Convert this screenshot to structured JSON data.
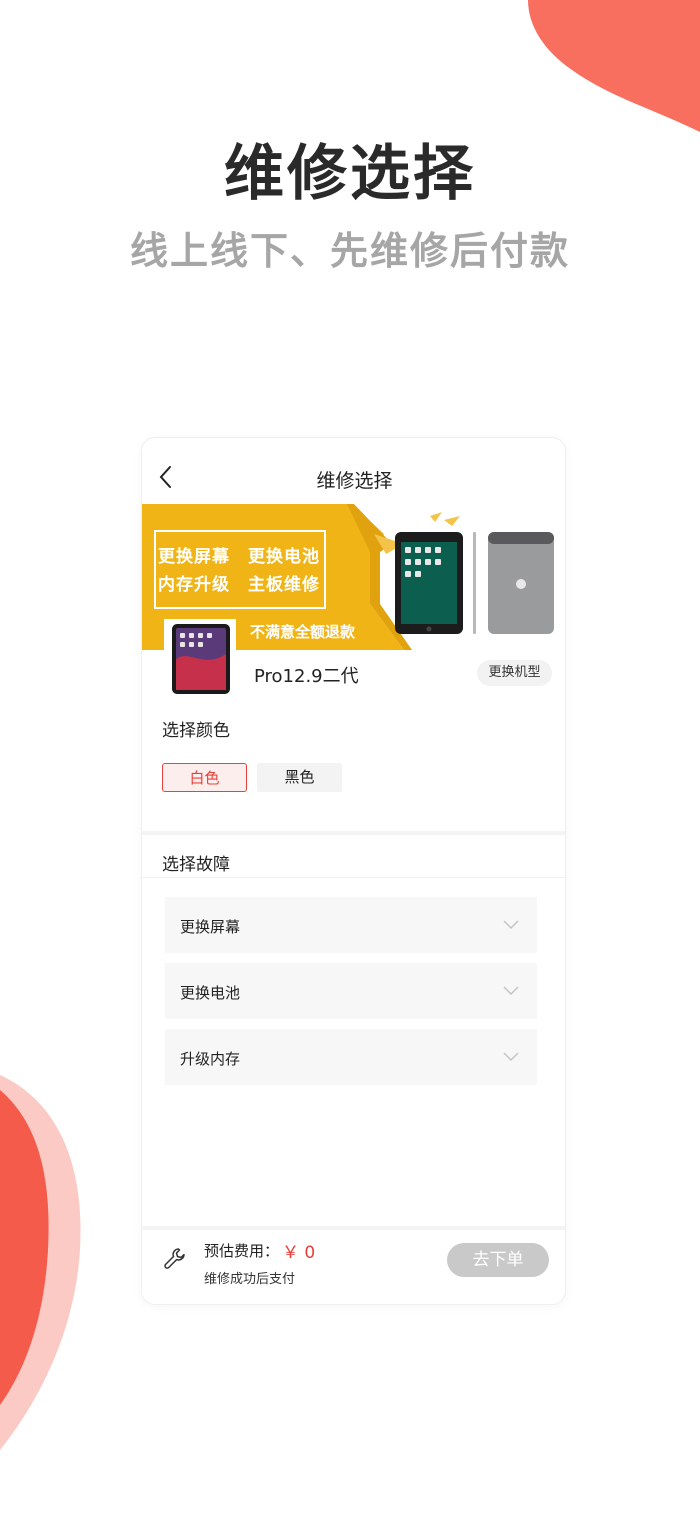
{
  "promo": {
    "title": "维修选择",
    "subtitle": "线上线下、先维修后付款"
  },
  "screen": {
    "nav_title": "维修选择",
    "banner": {
      "line1": "更换屏幕　更换电池",
      "line2": "内存升级　主板维修",
      "refund": "不满意全额退款"
    },
    "product": {
      "name": "Pro12.9二代",
      "change_model_label": "更换机型"
    },
    "color_section": {
      "label": "选择颜色",
      "options": [
        "白色",
        "黑色"
      ],
      "selected": "白色"
    },
    "fault_section": {
      "label": "选择故障",
      "items": [
        "更换屏幕",
        "更换电池",
        "升级内存"
      ]
    },
    "footer": {
      "fee_label": "预估费用：",
      "fee_value": "￥ 0",
      "note": "维修成功后支付",
      "order_button": "去下单"
    }
  },
  "colors": {
    "accent_red": "#e8403a",
    "deco_coral": "#f86f5f",
    "banner_yellow": "#f0b417",
    "button_disabled": "#c9c9c9"
  }
}
